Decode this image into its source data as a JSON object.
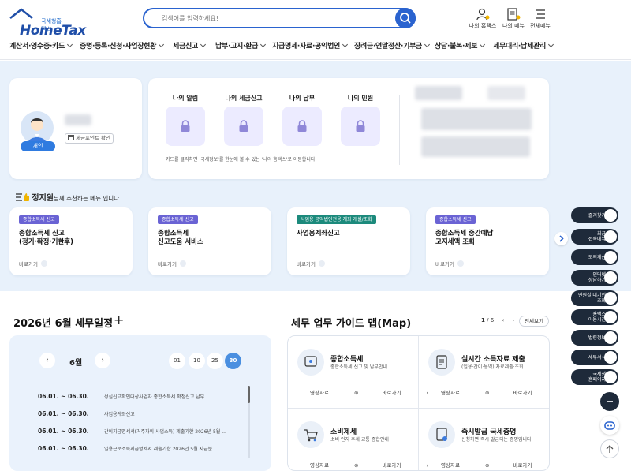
{
  "header": {
    "logo_small": "국세청홈택스",
    "logo_main": "HomeTax",
    "search_placeholder": "검색어를 입력하세요!",
    "tools": [
      "나의 홈택스",
      "나의 메뉴",
      "전체메뉴"
    ]
  },
  "gnb": [
    "계산서·영수증·카드",
    "증명·등록·신청·사업장현황",
    "세금신고",
    "납부·고지·환급",
    "지급명세·자료·공익법인",
    "장려금·연말정산·기부금",
    "상담·불복·제보",
    "세무대리·납세관리"
  ],
  "profile": {
    "badge": "개인",
    "point_button": "세금포인트 확인"
  },
  "my": {
    "tabs": [
      "나의 알림",
      "나의 세금신고",
      "나의 납부",
      "나의 민원"
    ],
    "hint": "카드를 클릭하면 '국세정보'를 한눈에 볼 수 있는 '나의 홈택스'로 이동합니다."
  },
  "recommend": {
    "name": "정지원",
    "suffix": "님께 추천하는 메뉴 입니다.",
    "cards": [
      {
        "tag": "종합소득세 신고",
        "title": "종합소득세 신고\n(정기·확정·기한후)",
        "go": "바로가기"
      },
      {
        "tag": "종합소득세 신고",
        "title": "종합소득세\n신고도움 서비스",
        "go": "바로가기"
      },
      {
        "tag": "사업용·공익법인전용 계좌 개설/조회",
        "title": "사업용계좌신고",
        "go": "바로가기"
      },
      {
        "tag": "종합소득세 신고",
        "title": "종합소득세 중간예납\n고지세액 조회",
        "go": "바로가기"
      }
    ]
  },
  "quick_menu": [
    "즐겨찾기",
    "최근\n접속메뉴",
    "모의계산",
    "인터넷\n상담하기",
    "민원실 대기인\n조회",
    "홈택스\n이용시간",
    "법령정보",
    "세무서식",
    "국세청\n홈페이지"
  ],
  "schedule": {
    "title": "2026년 6월 세무일정",
    "month": "6월",
    "days": [
      "01",
      "10",
      "25",
      "30"
    ],
    "selected_day": "30",
    "rows": [
      {
        "date": "06.01. ~ 06.30.",
        "text": "성실신고확인대상사업자 종합소득세 확정신고 납부"
      },
      {
        "date": "06.01. ~ 06.30.",
        "text": "사업용계좌신고"
      },
      {
        "date": "06.01. ~ 06.30.",
        "text": "간이지급명세서(거주자의 사업소득) 제출기한 2026년 5월 ..."
      },
      {
        "date": "06.01. ~ 06.30.",
        "text": "일용근로소득지급명세서 제출기한 2026년 5월 지급분"
      }
    ]
  },
  "guide": {
    "title": "세무 업무 가이드 맵(Map)",
    "page_current": "1",
    "page_total": "/ 6",
    "all_label": "전체보기",
    "video_label": "영상자료",
    "go_label": "바로가기",
    "items": [
      {
        "name": "종합소득세",
        "desc": "종합소득세 신고 및 납부안내"
      },
      {
        "name": "실시간 소득자료 제출",
        "desc": "(일용·간이·용역) 자료제출·조회"
      },
      {
        "name": "소비제세",
        "desc": "소비·인지·주세·교통 종합안내"
      },
      {
        "name": "즉시발급 국세증명",
        "desc": "신청하면 즉시 발급되는 증명입니다"
      }
    ]
  },
  "colors": {
    "primary": "#2a63cf",
    "hero_bg": "#e8f1fb",
    "quick_bg": "#1e2a3a"
  }
}
